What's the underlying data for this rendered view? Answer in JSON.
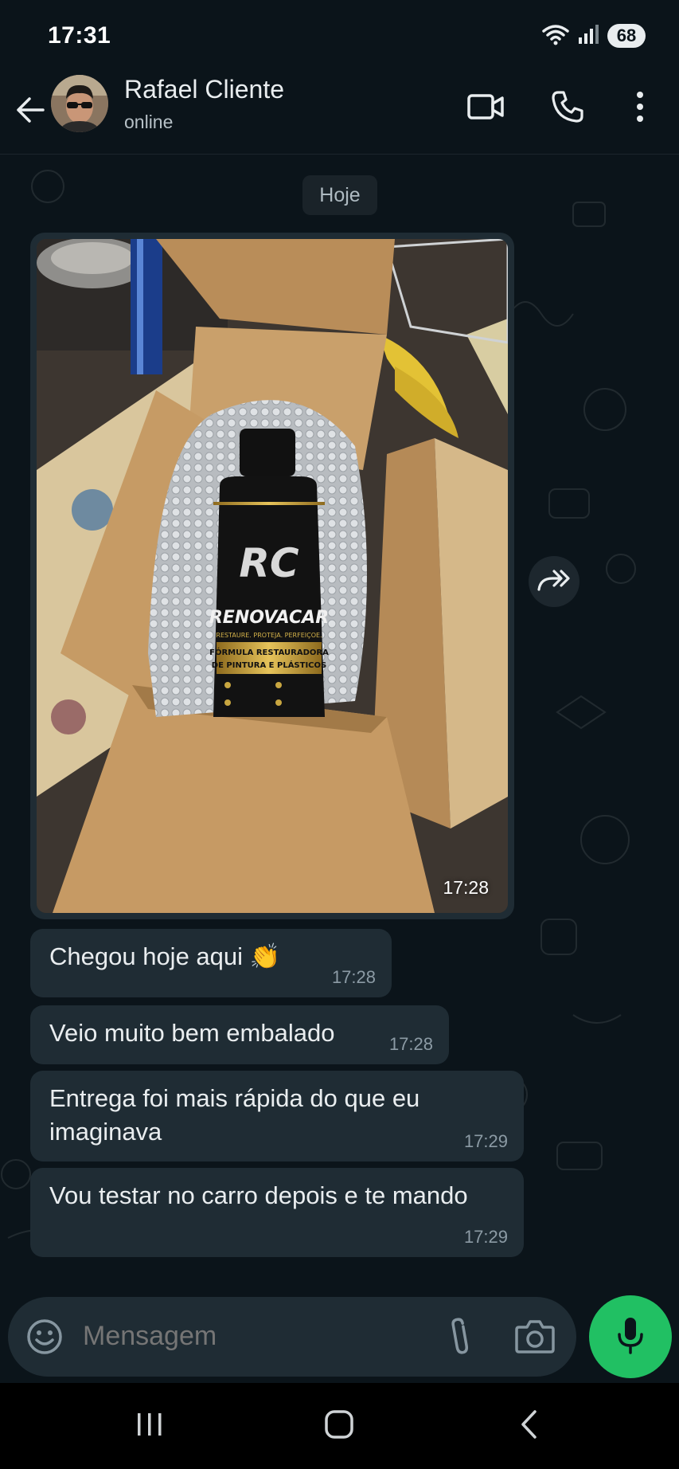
{
  "status_bar": {
    "time": "17:31",
    "battery": "68",
    "icons": [
      "wifi-icon",
      "signal-icon",
      "battery-icon"
    ]
  },
  "header": {
    "contact_name": "Rafael Cliente",
    "contact_status": "online",
    "icons": [
      "back-arrow-icon",
      "video-call-icon",
      "voice-call-icon",
      "more-options-icon"
    ]
  },
  "chat": {
    "date_chip": "Hoje",
    "image_message": {
      "time": "17:28",
      "photo_label": {
        "logo": "RC",
        "brand": "RENOVACAR",
        "tagline": "RESTAURE. PROTEJA. PERFEIÇOE.",
        "formula_line1": "FÓRMULA RESTAURADORA",
        "formula_line2": "DE PINTURA E PLÁSTICOS"
      }
    },
    "messages": [
      {
        "text": "Chegou hoje aqui 👏",
        "time": "17:28"
      },
      {
        "text": "Veio muito bem embalado",
        "time": "17:28"
      },
      {
        "text": "Entrega foi mais rápida do que eu imaginava",
        "time": "17:29"
      },
      {
        "text": "Vou testar no carro depois e te mando",
        "time": "17:29"
      }
    ]
  },
  "composer": {
    "placeholder": "Mensagem",
    "icons": [
      "emoji-icon",
      "attach-icon",
      "camera-icon",
      "mic-icon"
    ]
  },
  "colors": {
    "background": "#0b141a",
    "bubble": "#1f2c34",
    "accent_green": "#21c063"
  }
}
